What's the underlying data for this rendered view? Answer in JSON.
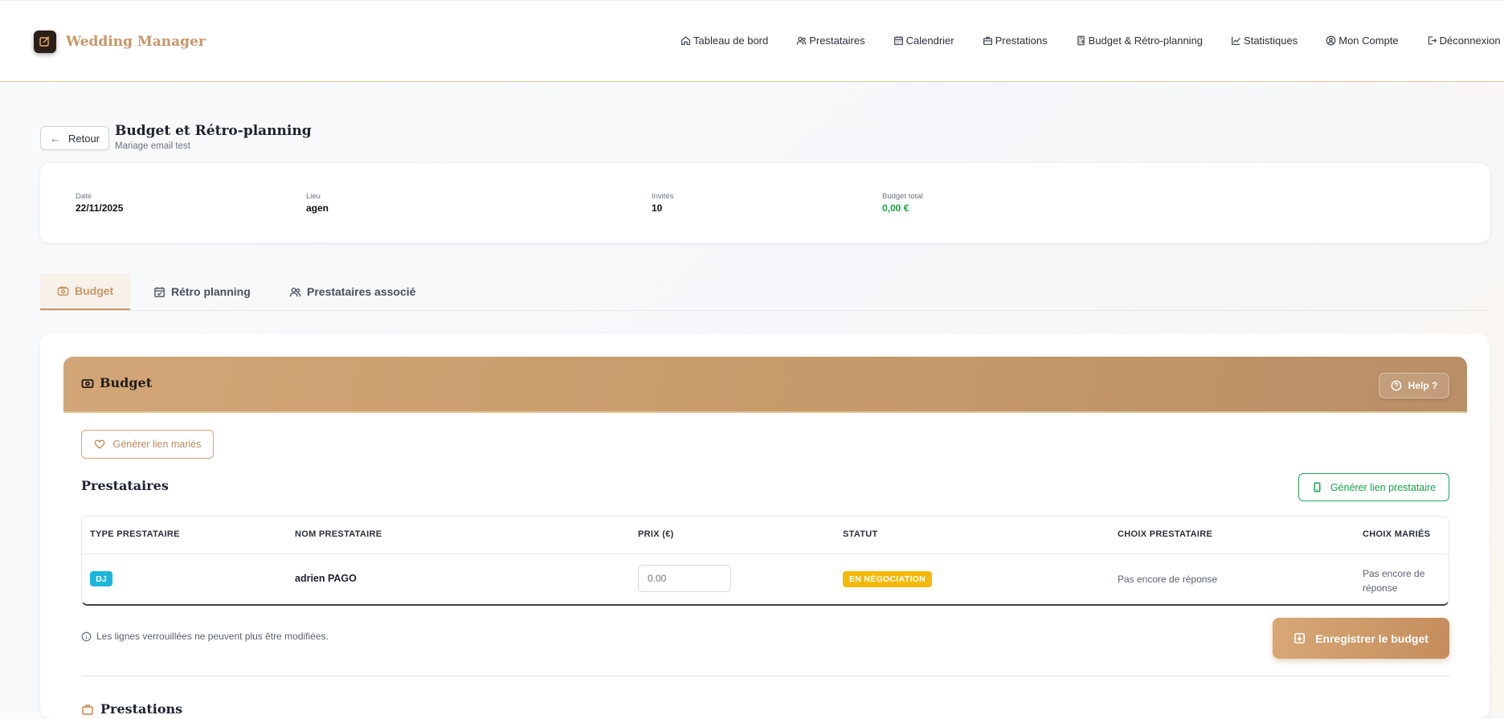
{
  "brand": {
    "name": "Wedding Manager"
  },
  "nav": [
    {
      "label": "Tableau de bord",
      "icon": "home-icon"
    },
    {
      "label": "Prestataires",
      "icon": "users-icon"
    },
    {
      "label": "Calendrier",
      "icon": "calendar-icon"
    },
    {
      "label": "Prestations",
      "icon": "briefcase-icon"
    },
    {
      "label": "Budget & Rétro-planning",
      "icon": "calculator-icon"
    },
    {
      "label": "Statistiques",
      "icon": "chart-icon"
    },
    {
      "label": "Mon Compte",
      "icon": "user-circle-icon"
    },
    {
      "label": "Déconnexion",
      "icon": "logout-icon"
    }
  ],
  "page": {
    "back_label": "Retour",
    "title": "Budget et Rétro-planning",
    "subtitle": "Mariage email test"
  },
  "info": {
    "date_label": "Date",
    "date_value": "22/11/2025",
    "lieu_label": "Lieu",
    "lieu_value": "agen",
    "invites_label": "Invités",
    "invites_value": "10",
    "budget_label": "Budget total",
    "budget_value": "0,00 €"
  },
  "tabs": [
    {
      "label": "Budget",
      "active": true
    },
    {
      "label": "Rétro planning",
      "active": false
    },
    {
      "label": "Prestataires associé",
      "active": false
    }
  ],
  "budget": {
    "title": "Budget",
    "help_label": "Help ?",
    "gen_maries_label": "Générer lien mariés",
    "prestataires_title": "Prestataires",
    "gen_presta_label": "Générer lien prestataire",
    "columns": [
      "TYPE PRESTATAIRE",
      "NOM PRESTATAIRE",
      "PRIX (€)",
      "STATUT",
      "CHOIX PRESTATAIRE",
      "CHOIX MARIÉS"
    ],
    "rows": [
      {
        "type": "DJ",
        "nom": "adrien PAGO",
        "prix_placeholder": "0.00",
        "statut": "EN NÉGOCIATION",
        "choix_prestataire": "Pas encore de réponse",
        "choix_maries_line1": "Pas encore de",
        "choix_maries_line2": "réponse"
      }
    ],
    "locked_note": "Les lignes verrouillées ne peuvent plus être modifiées.",
    "save_label": "Enregistrer le budget",
    "prestations_title": "Prestations"
  },
  "colors": {
    "accent": "#c89566",
    "green": "#16a34a",
    "status_yellow": "#f6b90a",
    "badge_cyan": "#1cb6dc"
  }
}
